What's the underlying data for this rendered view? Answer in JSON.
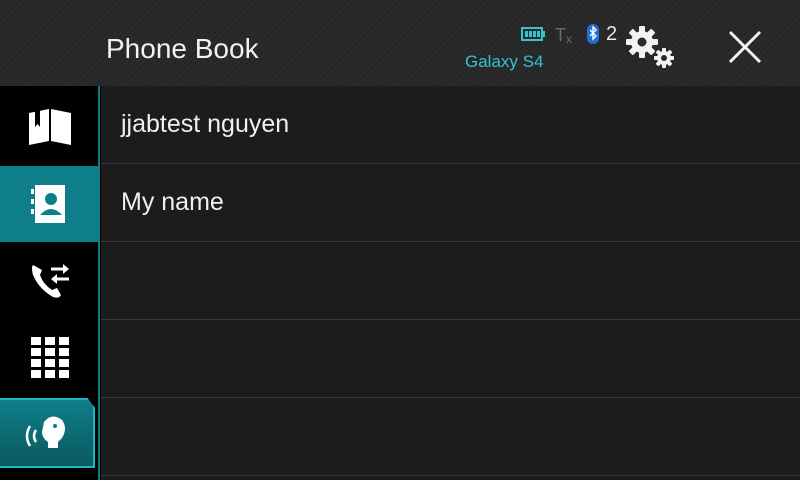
{
  "header": {
    "title": "Phone Book",
    "device_name": "Galaxy S4",
    "bluetooth_count": "2",
    "battery_icon": "battery-icon",
    "tx_icon": "signal-tx-icon",
    "bluetooth_icon": "bluetooth-icon",
    "settings_icon": "gear-icon",
    "close_icon": "close-icon"
  },
  "sidebar": {
    "items": [
      {
        "icon": "book-icon",
        "name": "sidebar-item-phonebook-book"
      },
      {
        "icon": "contact-card-icon",
        "name": "sidebar-item-contacts",
        "active": true
      },
      {
        "icon": "call-history-icon",
        "name": "sidebar-item-call-history"
      },
      {
        "icon": "keypad-icon",
        "name": "sidebar-item-keypad"
      },
      {
        "icon": "voice-recognition-icon",
        "name": "sidebar-item-voice"
      }
    ],
    "accent_color": "#0e7f88"
  },
  "contacts": [
    {
      "name": "jjabtest nguyen"
    },
    {
      "name": "My name"
    },
    {
      "name": ""
    },
    {
      "name": ""
    },
    {
      "name": ""
    }
  ],
  "colors": {
    "accent": "#34c3cf",
    "list_bg": "#1c1c1c",
    "divider": "#3a3a3a"
  }
}
